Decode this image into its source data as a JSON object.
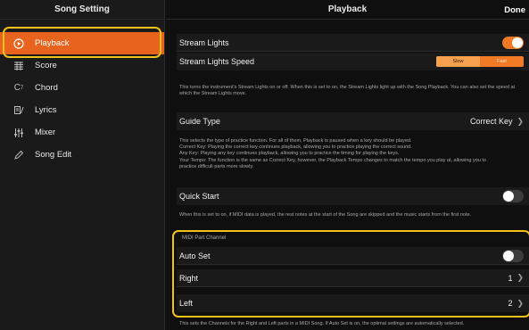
{
  "sidebar": {
    "title": "Song Setting",
    "items": [
      {
        "label": "Playback",
        "icon": "play-circle-icon",
        "active": true
      },
      {
        "label": "Score",
        "icon": "score-icon"
      },
      {
        "label": "Chord",
        "icon": "chord-icon"
      },
      {
        "label": "Lyrics",
        "icon": "lyrics-icon"
      },
      {
        "label": "Mixer",
        "icon": "mixer-icon"
      },
      {
        "label": "Song Edit",
        "icon": "pencil-icon"
      }
    ]
  },
  "header": {
    "title": "Playback",
    "done_label": "Done"
  },
  "stream_lights": {
    "label": "Stream Lights",
    "state": "on"
  },
  "stream_lights_speed": {
    "label": "Stream Lights Speed",
    "options": [
      "Slow",
      "Fast"
    ],
    "selected": "Slow"
  },
  "stream_desc": "This turns the instrument's Stream Lights on or off. When this is set to on, the Stream Lights light up with the Song Playback. You can also set the speed at which the Stream Lights move.",
  "guide_type": {
    "label": "Guide Type",
    "value": "Correct Key"
  },
  "guide_desc": [
    "This selects the type of practice function. For all of them, Playback is paused when a key should be played.",
    "Correct Key:  Playing the correct key continues playback, allowing you to practice playing the correct sound.",
    "Any Key:  Playing any key continues playback, allowing you to practice the timing for playing the keys.",
    "Your Tempo:  The function is the same as Correct Key, however, the Playback Tempo changes to match the tempo you play at, allowing you to",
    "practice difficult parts more slowly."
  ],
  "quick_start": {
    "label": "Quick Start",
    "state": "off"
  },
  "quick_desc": "When this is set to on, if MIDI data is played, the rest notes at the start of the Song are skipped and the music starts from the first note.",
  "midi": {
    "section_label": "MIDI Part Channel",
    "auto_set": {
      "label": "Auto Set",
      "state": "off"
    },
    "right": {
      "label": "Right",
      "value": "1"
    },
    "left": {
      "label": "Left",
      "value": "2"
    },
    "desc": "This sets the Channels for the Right and Left parts in a MIDI Song. If Auto Set is on, the optimal settings are automatically selected."
  },
  "colors": {
    "accent": "#e8641e",
    "toggle_on": "#f07a25",
    "highlight": "#f3c21a",
    "background": "#0f0f0f"
  }
}
